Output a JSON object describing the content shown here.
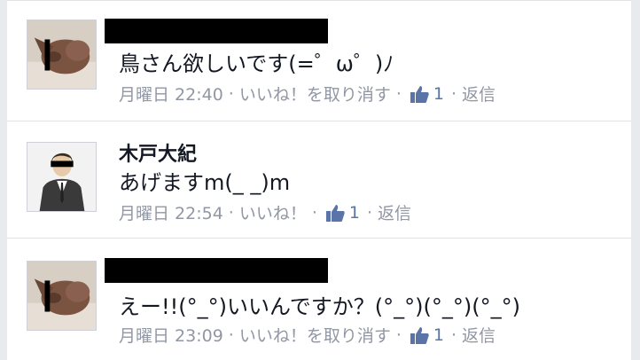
{
  "colors": {
    "frame": "#e9eaee",
    "text": "#141823",
    "meta": "#9197a3",
    "like_blue": "#5b74a8",
    "redaction": "#000000"
  },
  "comments": [
    {
      "author": "",
      "author_redacted": true,
      "avatar": "dog-photo",
      "text": "鳥さん欲しいです(=゜ω゜)ﾉ",
      "time": "月曜日 22:40",
      "like_action": "いいね！を取り消す",
      "like_icon": "thumbs-up-icon",
      "like_count": "1",
      "reply": "返信"
    },
    {
      "author": "木戸大紀",
      "author_redacted": false,
      "avatar": "person-in-suit-photo",
      "text": "あげますm(_ _)m",
      "time": "月曜日 22:54",
      "like_action": "いいね！",
      "like_icon": "thumbs-up-icon",
      "like_count": "1",
      "reply": "返信"
    },
    {
      "author": "",
      "author_redacted": true,
      "avatar": "dog-photo",
      "text": "えー!!(°_°)いいんですか？(°_°)(°_°)(°_°)",
      "time": "月曜日 23:09",
      "like_action": "いいね！を取り消す",
      "like_icon": "thumbs-up-icon",
      "like_count": "1",
      "reply": "返信"
    }
  ]
}
